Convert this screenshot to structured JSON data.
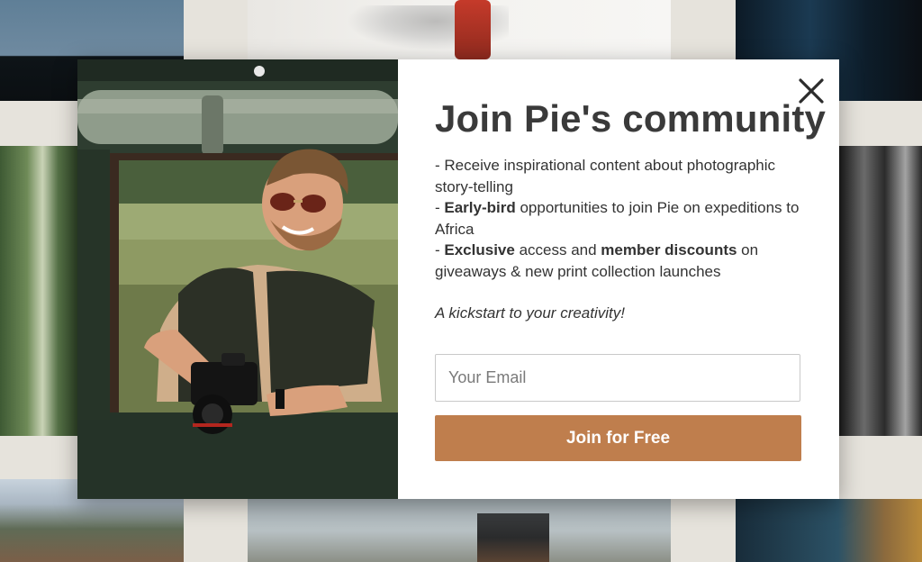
{
  "modal": {
    "title": "Join Pie's community",
    "benefits": [
      {
        "prefix": "- Receive inspirational content about photographic story-telling"
      },
      {
        "prefix": "- ",
        "bold": "Early-bird",
        "rest": " opportunities to join Pie on expeditions to Africa"
      },
      {
        "prefix": "- ",
        "bold": "Exclusive",
        "middle": " access and ",
        "bold2": "member discounts",
        "rest": " on giveaways & new print collection launches"
      }
    ],
    "tagline": "A kickstart to your creativity!",
    "email_placeholder": "Your Email",
    "email_value": "",
    "join_label": "Join for Free",
    "close_icon": "close-icon"
  },
  "colors": {
    "accent": "#bf7e4d",
    "title": "#3a3a3a",
    "body_text": "#333333",
    "background": "#e6e3dc"
  }
}
